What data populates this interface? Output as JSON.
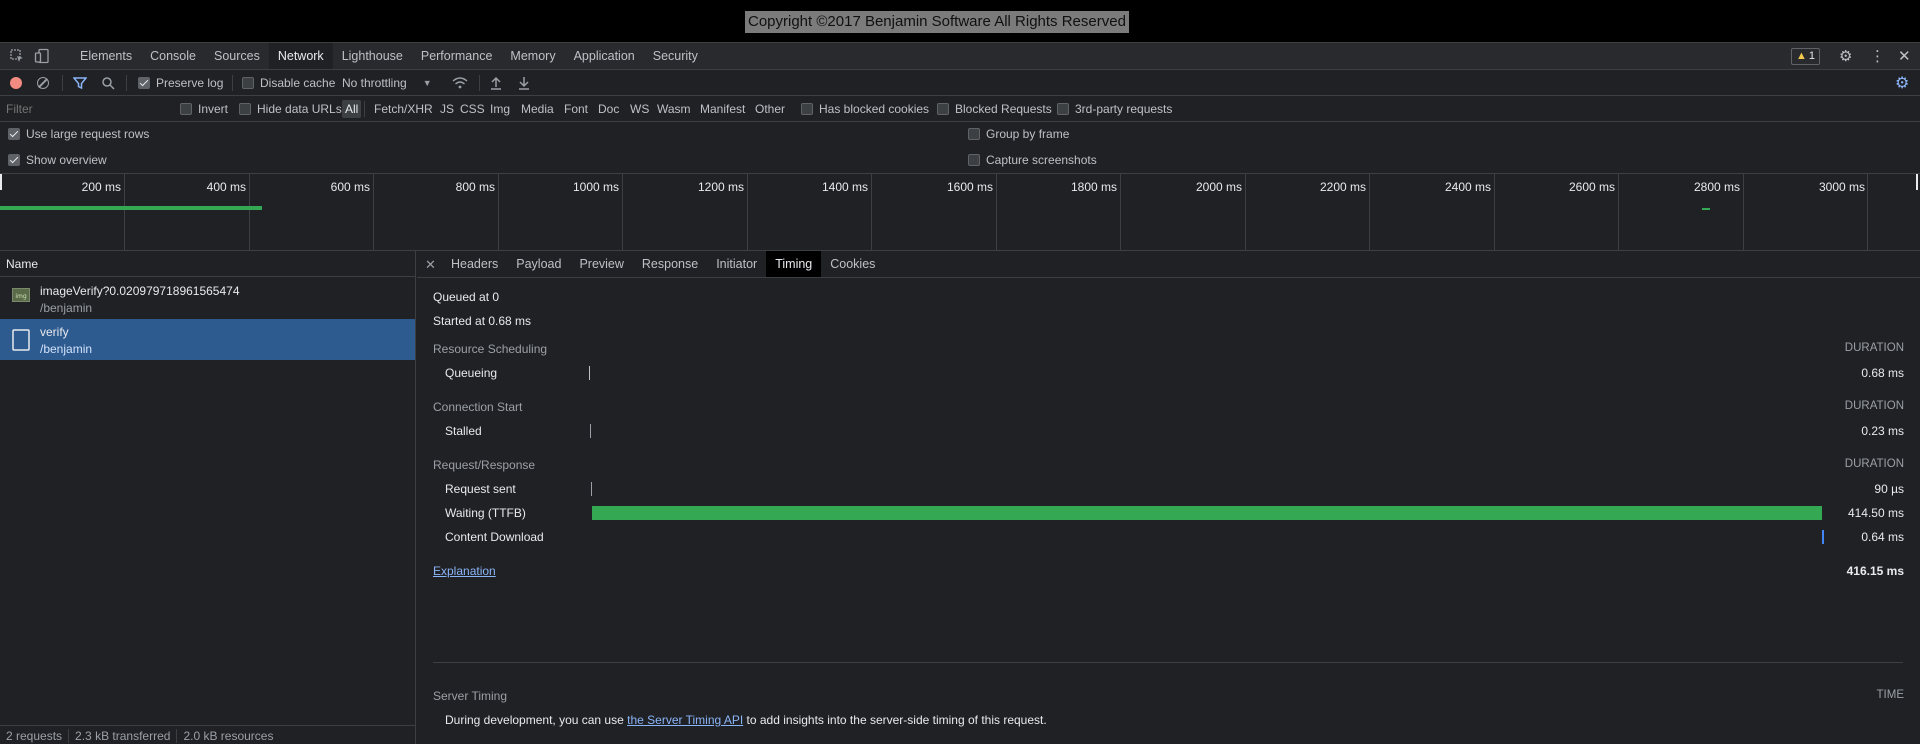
{
  "page": {
    "copyright": "Copyright ©2017 Benjamin Software All Rights Reserved"
  },
  "main_tabs": [
    "Elements",
    "Console",
    "Sources",
    "Network",
    "Lighthouse",
    "Performance",
    "Memory",
    "Application",
    "Security"
  ],
  "active_main_tab": "Network",
  "warnings_count": "1",
  "toolbar": {
    "preserve_log": "Preserve log",
    "disable_cache": "Disable cache",
    "throttling": "No throttling"
  },
  "filter": {
    "placeholder": "Filter",
    "invert": "Invert",
    "hide_data_urls": "Hide data URLs",
    "types": [
      "All",
      "Fetch/XHR",
      "JS",
      "CSS",
      "Img",
      "Media",
      "Font",
      "Doc",
      "WS",
      "Wasm",
      "Manifest",
      "Other"
    ],
    "active_type": "All",
    "has_blocked_cookies": "Has blocked cookies",
    "blocked_requests": "Blocked Requests",
    "third_party": "3rd-party requests"
  },
  "settings": {
    "large_rows": "Use large request rows",
    "show_overview": "Show overview",
    "group_by_frame": "Group by frame",
    "capture_screenshots": "Capture screenshots"
  },
  "overview": {
    "ticks": [
      "200 ms",
      "400 ms",
      "600 ms",
      "800 ms",
      "1000 ms",
      "1200 ms",
      "1400 ms",
      "1600 ms",
      "1800 ms",
      "2000 ms",
      "2200 ms",
      "2400 ms",
      "2600 ms",
      "2800 ms",
      "3000 ms"
    ]
  },
  "request_list": {
    "header": "Name",
    "rows": [
      {
        "name": "imageVerify?0.020979718961565474",
        "path": "/benjamin",
        "selected": false
      },
      {
        "name": "verify",
        "path": "/benjamin",
        "selected": true
      }
    ],
    "status": {
      "requests": "2 requests",
      "transferred": "2.3 kB transferred",
      "resources": "2.0 kB resources"
    }
  },
  "detail_tabs": [
    "Headers",
    "Payload",
    "Preview",
    "Response",
    "Initiator",
    "Timing",
    "Cookies"
  ],
  "active_detail_tab": "Timing",
  "timing": {
    "queued_at": "Queued at 0",
    "started_at": "Started at 0.68 ms",
    "duration_header": "DURATION",
    "resource_scheduling": "Resource Scheduling",
    "queueing_label": "Queueing",
    "queueing_value": "0.68 ms",
    "connection_start": "Connection Start",
    "stalled_label": "Stalled",
    "stalled_value": "0.23 ms",
    "request_response": "Request/Response",
    "request_sent_label": "Request sent",
    "request_sent_value": "90 µs",
    "waiting_label": "Waiting (TTFB)",
    "waiting_value": "414.50 ms",
    "content_download_label": "Content Download",
    "content_download_value": "0.64 ms",
    "explanation": "Explanation",
    "total": "416.15 ms",
    "server_timing": "Server Timing",
    "time_header": "TIME",
    "server_text_before": "During development, you can use",
    "server_link": "the Server Timing API",
    "server_text_after": "to add insights into the server-side timing of this request."
  }
}
